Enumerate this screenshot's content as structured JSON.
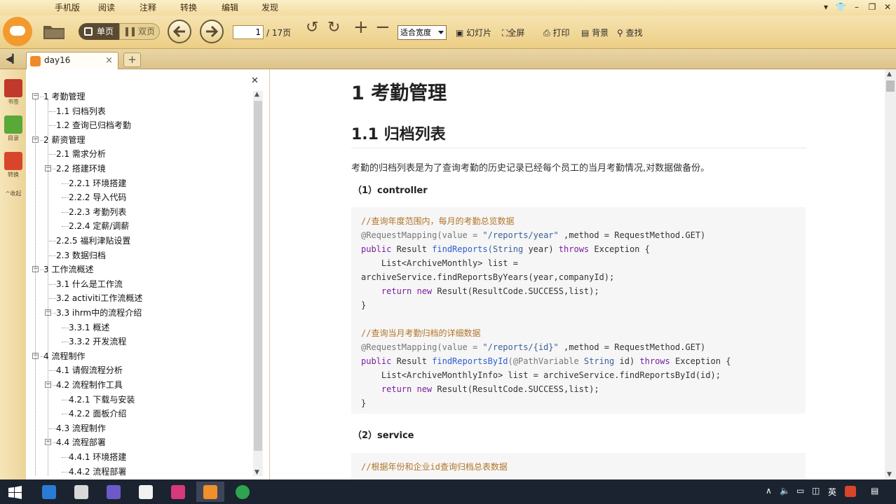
{
  "menu": {
    "items": [
      "手机版",
      "阅读",
      "注释",
      "转换",
      "编辑",
      "发现"
    ]
  },
  "toolbar": {
    "single_label": "单页",
    "double_label": "双页",
    "page_current": "1",
    "page_total": "/ 17页",
    "zoom_value": "适合宽度",
    "slideshow_label": "幻灯片",
    "fullscreen_label": "全屏",
    "print_label": "打印",
    "background_label": "背景",
    "find_label": "查找"
  },
  "tabs": [
    {
      "label": "day16"
    }
  ],
  "rail": {
    "bookmark": "书签",
    "toc": "目录",
    "convert": "转换",
    "collapse": "^收起"
  },
  "toc": {
    "items": [
      {
        "label": "1 考勤管理",
        "level": 0,
        "toggle": "-"
      },
      {
        "label": "1.1 归档列表",
        "level": 1
      },
      {
        "label": "1.2 查询已归档考勤",
        "level": 1
      },
      {
        "label": "2 薪资管理",
        "level": 0,
        "toggle": "-"
      },
      {
        "label": "2.1 需求分析",
        "level": 1
      },
      {
        "label": "2.2 搭建环境",
        "level": 1,
        "toggle": "-"
      },
      {
        "label": "2.2.1 环境搭建",
        "level": 2
      },
      {
        "label": "2.2.2 导入代码",
        "level": 2
      },
      {
        "label": "2.2.3 考勤列表",
        "level": 2
      },
      {
        "label": "2.2.4 定薪/调薪",
        "level": 2
      },
      {
        "label": "2.2.5 福利津贴设置",
        "level": 1
      },
      {
        "label": "2.3 数据归档",
        "level": 1
      },
      {
        "label": "3 工作流概述",
        "level": 0,
        "toggle": "-"
      },
      {
        "label": "3.1 什么是工作流",
        "level": 1
      },
      {
        "label": "3.2 activiti工作流概述",
        "level": 1
      },
      {
        "label": "3.3 ihrm中的流程介绍",
        "level": 1,
        "toggle": "-"
      },
      {
        "label": "3.3.1 概述",
        "level": 2
      },
      {
        "label": "3.3.2 开发流程",
        "level": 2
      },
      {
        "label": "4 流程制作",
        "level": 0,
        "toggle": "-"
      },
      {
        "label": "4.1 请假流程分析",
        "level": 1
      },
      {
        "label": "4.2 流程制作工具",
        "level": 1,
        "toggle": "-"
      },
      {
        "label": "4.2.1 下载与安装",
        "level": 2
      },
      {
        "label": "4.2.2 面板介绍",
        "level": 2
      },
      {
        "label": "4.3 流程制作",
        "level": 1
      },
      {
        "label": "4.4 流程部署",
        "level": 1,
        "toggle": "-"
      },
      {
        "label": "4.4.1 环境搭建",
        "level": 2
      },
      {
        "label": "4.4.2 流程部署",
        "level": 2
      }
    ]
  },
  "doc": {
    "h1": "1 考勤管理",
    "h2": "1.1 归档列表",
    "para": "考勤的归档列表是为了查询考勤的历史记录已经每个员工的当月考勤情况,对数据做备份。",
    "sub1": "（1）controller",
    "sub2": "（2）service",
    "code1": {
      "c1": "//查询年度范围内，每月的考勤总览数据",
      "r1a": "@RequestMapping(value = ",
      "r1b": "\"/reports/year\"",
      "r1c": " ,method = RequestMethod.GET)",
      "r2a": "public",
      "r2b": " Result ",
      "r2c": "findReports",
      "r2d": "(String",
      "r2e": " year) ",
      "r2f": "throws",
      "r2g": " Exception {",
      "r3": "    List<ArchiveMonthly> list =",
      "r4": "archiveService.findReportsByYears(year,companyId);",
      "r5a": "    return new",
      "r5b": " Result(ResultCode.SUCCESS,list);",
      "r6": "}",
      "c2": "//查询当月考勤归档的详细数据",
      "r7a": "@RequestMapping(value = ",
      "r7b": "\"/reports/{id}\"",
      "r7c": " ,method = RequestMethod.GET)",
      "r8a": "public",
      "r8b": " Result ",
      "r8c": "findReportsById",
      "r8d": "(@PathVariable",
      "r8e": " String",
      "r8f": " id) ",
      "r8g": "throws",
      "r8h": " Exception {",
      "r9": "    List<ArchiveMonthlyInfo> list = archiveService.findReportsById(id);",
      "r10a": "    return new",
      "r10b": " Result(ResultCode.SUCCESS,list);",
      "r11": "}"
    },
    "code2": {
      "c1": "//根据年份和企业id查询归档总表数据"
    }
  },
  "tray": {
    "ime": "英"
  }
}
